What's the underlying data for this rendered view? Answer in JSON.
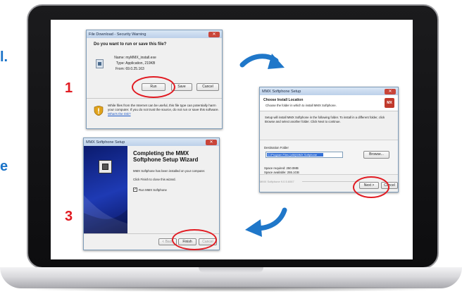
{
  "edge_text": {
    "left_top": "l.",
    "left_mid": "e"
  },
  "steps": {
    "one": "1",
    "three": "3"
  },
  "colors": {
    "accent_red": "#e11b22",
    "arrow_blue": "#1f77c9"
  },
  "win1": {
    "title": "File Download - Security Warning",
    "question": "Do you want to run or save this file?",
    "name_label": "Name:",
    "name_value": "myMMX_install.exe",
    "type_label": "Type:",
    "type_value": "Application, 219KB",
    "from_label": "From:",
    "from_value": "69.0.25.163",
    "run": "Run",
    "save": "Save",
    "cancel": "Cancel",
    "warning": "While files from the Internet can be useful, this file type can potentially harm your computer. If you do not trust the source, do not run or save this software.",
    "risk_link": "What's the risk?"
  },
  "win2": {
    "title": "MMX Softphone Setup",
    "heading": "Choose Install Location",
    "subheading": "Choose the folder in which to install MMX Softphone.",
    "body": "Setup will install MMX Softphone in the following folder. To install in a different folder, click Browse and select another folder. Click Next to continue.",
    "dest_label": "Destination Folder",
    "dest_value": "C:\\Program Files (x86)\\MMX Softphone",
    "browse": "Browse...",
    "space_required": "Space required: 250.0MB",
    "space_available": "Space available: 255.1GB",
    "version": "MMX Softphone 9.0.5.6067",
    "next": "Next >",
    "cancel": "Cancel"
  },
  "win3": {
    "title": "MMX Softphone Setup",
    "heading": "Completing the MMX Softphone Setup Wizard",
    "line1": "MMX Softphone has been installed on your computer.",
    "line2": "Click Finish to close this wizard.",
    "checkbox_label": "Run MMX Softphone",
    "back": "< Back",
    "finish": "Finish",
    "cancel": "Cancel"
  }
}
